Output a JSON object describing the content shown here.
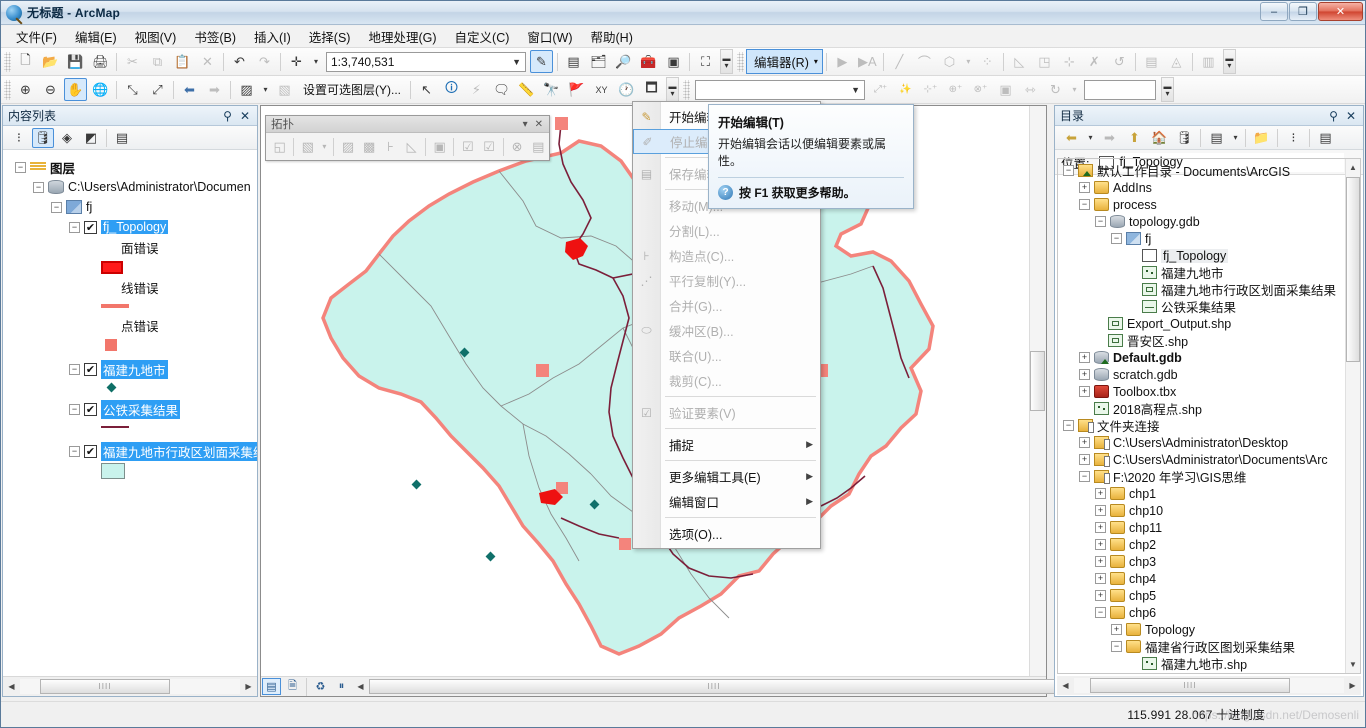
{
  "window": {
    "title": "无标题 - ArcMap",
    "minimize": "–",
    "maximize": "❐",
    "close": "✕"
  },
  "menubar": {
    "items": [
      {
        "label": "文件(F)"
      },
      {
        "label": "编辑(E)"
      },
      {
        "label": "视图(V)"
      },
      {
        "label": "书签(B)"
      },
      {
        "label": "插入(I)"
      },
      {
        "label": "选择(S)"
      },
      {
        "label": "地理处理(G)"
      },
      {
        "label": "自定义(C)"
      },
      {
        "label": "窗口(W)"
      },
      {
        "label": "帮助(H)"
      }
    ]
  },
  "toolbar_standard": {
    "scale_value": "1:3,740,531",
    "buttons": [
      {
        "name": "new-document",
        "glyph": "🗋"
      },
      {
        "name": "open-document",
        "glyph": "📂"
      },
      {
        "name": "save-document",
        "glyph": "💾"
      },
      {
        "name": "print-document",
        "glyph": "🖨"
      },
      {
        "name": "cut",
        "glyph": "✂"
      },
      {
        "name": "copy",
        "glyph": "⧉"
      },
      {
        "name": "paste",
        "glyph": "📋"
      },
      {
        "name": "delete",
        "glyph": "✕"
      },
      {
        "name": "undo",
        "glyph": "↶"
      },
      {
        "name": "redo",
        "glyph": "↷"
      },
      {
        "name": "add-data",
        "glyph": "✛"
      }
    ],
    "right_buttons": [
      {
        "name": "editor-toolbar-toggle",
        "glyph": "✎"
      },
      {
        "name": "table-of-contents",
        "glyph": "▤"
      },
      {
        "name": "catalog-window",
        "glyph": "🗂"
      },
      {
        "name": "search-window",
        "glyph": "🔎"
      },
      {
        "name": "arctoolbox-window",
        "glyph": "🧰"
      },
      {
        "name": "python-window",
        "glyph": "▣"
      },
      {
        "name": "model-builder",
        "glyph": "⛶"
      }
    ]
  },
  "toolbar_tools": {
    "select_layer_label": "设置可选图层(Y)...",
    "buttons": [
      {
        "name": "zoom-in",
        "glyph": "⊕"
      },
      {
        "name": "zoom-out",
        "glyph": "⊖"
      },
      {
        "name": "pan",
        "glyph": "✋"
      },
      {
        "name": "full-extent",
        "glyph": "🌐"
      },
      {
        "name": "fixed-zoom-in",
        "glyph": "⤡"
      },
      {
        "name": "fixed-zoom-out",
        "glyph": "⤢"
      },
      {
        "name": "previous-extent",
        "glyph": "⬅"
      },
      {
        "name": "next-extent",
        "glyph": "➡"
      },
      {
        "name": "select-features",
        "glyph": "▨"
      },
      {
        "name": "clear-selection",
        "glyph": "▧"
      },
      {
        "name": "select-elements",
        "glyph": "↖"
      },
      {
        "name": "identify",
        "glyph": "🛈"
      },
      {
        "name": "hyperlink",
        "glyph": "⚡"
      },
      {
        "name": "html-popup",
        "glyph": "🗨"
      },
      {
        "name": "measure",
        "glyph": "📏"
      },
      {
        "name": "find",
        "glyph": "🔭"
      },
      {
        "name": "find-route",
        "glyph": "🚩"
      },
      {
        "name": "go-to-xy",
        "glyph": "XY"
      },
      {
        "name": "time-slider",
        "glyph": "🕐"
      },
      {
        "name": "create-viewer-window",
        "glyph": "🗖"
      }
    ]
  },
  "editor_toolbar": {
    "button_label": "编辑器(R)",
    "caret": "▾",
    "tools": [
      {
        "name": "edit-tool",
        "glyph": "▶"
      },
      {
        "name": "edit-annotation-tool",
        "glyph": "▶A"
      },
      {
        "name": "straight-segment",
        "glyph": "╱"
      },
      {
        "name": "curve-segment",
        "glyph": "⌒"
      },
      {
        "name": "trace-tool",
        "glyph": "⬡"
      },
      {
        "name": "split-tool",
        "glyph": "⁘"
      },
      {
        "name": "reshape-feature",
        "glyph": "◺"
      },
      {
        "name": "rotate-tool",
        "glyph": "◳"
      },
      {
        "name": "mirror-features",
        "glyph": "⊹"
      },
      {
        "name": "topology-edit",
        "glyph": "✗"
      },
      {
        "name": "modify-feature",
        "glyph": "↺"
      },
      {
        "name": "attributes",
        "glyph": "▤"
      },
      {
        "name": "sketch-properties",
        "glyph": "◬"
      },
      {
        "name": "create-features-window",
        "glyph": "▥"
      }
    ],
    "snapping_tools": [
      {
        "name": "create-feature",
        "glyph": "⤢⁺"
      },
      {
        "name": "magic-wand",
        "glyph": "✨"
      },
      {
        "name": "add-vertex",
        "glyph": "⊹⁺"
      },
      {
        "name": "append-vertex",
        "glyph": "⊕⁺"
      },
      {
        "name": "delete-vertex",
        "glyph": "⊗⁺"
      },
      {
        "name": "rectangle-tool",
        "glyph": "▣"
      },
      {
        "name": "dimension-tool",
        "glyph": "⇿"
      },
      {
        "name": "rotate",
        "glyph": "↻"
      }
    ],
    "angle_value": ""
  },
  "editor_menu": {
    "items": [
      {
        "label": "开始编辑(T)",
        "icon": "pencil-start-icon",
        "glyph": "✎",
        "state": "highlighted",
        "submenu": false
      },
      {
        "label": "停止编辑",
        "icon": "pencil-stop-icon",
        "glyph": "✐",
        "state": "disabled-selected",
        "submenu": false
      },
      {
        "label": "保存编辑",
        "icon": "save-edits-icon",
        "glyph": "▤",
        "state": "disabled",
        "submenu": false
      },
      {
        "label": "移动(M)...",
        "icon": "",
        "glyph": "",
        "state": "disabled",
        "submenu": false
      },
      {
        "label": "分割(L)...",
        "icon": "",
        "glyph": "",
        "state": "disabled",
        "submenu": false
      },
      {
        "label": "构造点(C)...",
        "icon": "construct-points-icon",
        "glyph": "⊦",
        "state": "disabled",
        "submenu": false
      },
      {
        "label": "平行复制(Y)...",
        "icon": "copy-parallel-icon",
        "glyph": "⋰",
        "state": "disabled",
        "submenu": false
      },
      {
        "label": "合并(G)...",
        "icon": "",
        "glyph": "",
        "state": "disabled",
        "submenu": false
      },
      {
        "label": "缓冲区(B)...",
        "icon": "buffer-icon",
        "glyph": "⬭",
        "state": "disabled",
        "submenu": false
      },
      {
        "label": "联合(U)...",
        "icon": "",
        "glyph": "",
        "state": "disabled",
        "submenu": false
      },
      {
        "label": "裁剪(C)...",
        "icon": "",
        "glyph": "",
        "state": "disabled",
        "submenu": false
      },
      {
        "label": "验证要素(V)",
        "icon": "validate-features-icon",
        "glyph": "☑",
        "state": "disabled",
        "submenu": false
      },
      {
        "label": "捕捉",
        "icon": "",
        "glyph": "",
        "state": "enabled",
        "submenu": true
      },
      {
        "label": "更多编辑工具(E)",
        "icon": "",
        "glyph": "",
        "state": "enabled",
        "submenu": true
      },
      {
        "label": "编辑窗口",
        "icon": "",
        "glyph": "",
        "state": "enabled",
        "submenu": true
      },
      {
        "label": "选项(O)...",
        "icon": "",
        "glyph": "",
        "state": "enabled",
        "submenu": false
      }
    ],
    "separators_after": [
      2,
      5,
      10,
      11,
      12,
      14
    ],
    "submenu_arrow": "▶"
  },
  "tooltip": {
    "title": "开始编辑(T)",
    "body": "开始编辑会话以便编辑要素或属性。",
    "footer": "按 F1 获取更多帮助。",
    "help_glyph": "?"
  },
  "toc": {
    "title": "内容列表",
    "pin": "📌",
    "close": "✕",
    "tools": [
      {
        "name": "list-by-drawing-order",
        "glyph": "⁝"
      },
      {
        "name": "list-by-source",
        "glyph": "🛢",
        "active": true
      },
      {
        "name": "list-by-visibility",
        "glyph": "◈"
      },
      {
        "name": "list-by-selection",
        "glyph": "◩"
      },
      {
        "name": "options",
        "glyph": "▤"
      }
    ],
    "tree": [
      {
        "indent": 0,
        "expander": "−",
        "icon": "layers-icon",
        "label": "图层",
        "bold": true,
        "checkbox": false,
        "selected": false
      },
      {
        "indent": 1,
        "expander": "−",
        "icon": "gdb-icon",
        "label": "C:\\Users\\Administrator\\Documen",
        "checkbox": false,
        "selected": false
      },
      {
        "indent": 2,
        "expander": "−",
        "icon": "feature-dataset-icon",
        "label": "fj",
        "checkbox": false,
        "selected": false
      },
      {
        "indent": 3,
        "expander": "−",
        "icon": "topology-icon",
        "label": "fj_Topology",
        "checkbox": true,
        "selected": true
      },
      {
        "indent": 5,
        "expander": "",
        "icon": "",
        "label": "面错误",
        "checkbox": false,
        "selected": false
      },
      {
        "indent": 5,
        "swatch": "polygon-error-swatch",
        "label": ""
      },
      {
        "indent": 5,
        "expander": "",
        "icon": "",
        "label": "线错误",
        "checkbox": false,
        "selected": false
      },
      {
        "indent": 5,
        "swatch": "line-error-swatch",
        "label": ""
      },
      {
        "indent": 5,
        "expander": "",
        "icon": "",
        "label": "点错误",
        "checkbox": false,
        "selected": false
      },
      {
        "indent": 5,
        "swatch": "point-error-swatch",
        "label": ""
      },
      {
        "indent": 3,
        "expander": "−",
        "icon": "",
        "label": "福建九地市",
        "checkbox": true,
        "selected": true
      },
      {
        "indent": 5,
        "swatch": "dot-swatch",
        "label": ""
      },
      {
        "indent": 3,
        "expander": "−",
        "icon": "",
        "label": "公铁采集结果",
        "checkbox": true,
        "selected": true
      },
      {
        "indent": 5,
        "swatch": "line-swatch",
        "label": ""
      },
      {
        "indent": 3,
        "expander": "−",
        "icon": "",
        "label": "福建九地市行政区划面采集结",
        "checkbox": true,
        "selected": true
      },
      {
        "indent": 5,
        "swatch": "polygon-swatch",
        "label": ""
      }
    ]
  },
  "topology_toolbar": {
    "title": "拓扑",
    "collapse": "▾",
    "close": "✕",
    "buttons": [
      {
        "name": "map-topology-icon",
        "glyph": "◱"
      },
      {
        "name": "select-topology-icon",
        "glyph": "▧"
      },
      {
        "name": "topology-dropdown-caret",
        "glyph": "▾"
      },
      {
        "name": "show-shared-features-icon",
        "glyph": "▨"
      },
      {
        "name": "modify-edge-icon",
        "glyph": "▩"
      },
      {
        "name": "reshape-edge-icon",
        "glyph": "⊦"
      },
      {
        "name": "construct-features-icon",
        "glyph": "◺"
      },
      {
        "name": "planarize-lines-icon",
        "glyph": "▣"
      },
      {
        "name": "validate-topology-current-extent-icon",
        "glyph": "☑"
      },
      {
        "name": "validate-topology-specified-area-icon",
        "glyph": "☑"
      },
      {
        "name": "fix-topology-error-icon",
        "glyph": "⊗"
      },
      {
        "name": "error-inspector-icon",
        "glyph": "▤"
      }
    ]
  },
  "catalog": {
    "title": "目录",
    "pin": "📌",
    "close": "✕",
    "tools": [
      {
        "name": "back-icon",
        "glyph": "⬅"
      },
      {
        "name": "back-dropdown-caret",
        "glyph": "▾"
      },
      {
        "name": "forward-icon",
        "glyph": "➡"
      },
      {
        "name": "up-one-level-icon",
        "glyph": "⬆"
      },
      {
        "name": "home-icon",
        "glyph": "🏠"
      },
      {
        "name": "default-geodatabase-icon",
        "glyph": "🛢"
      },
      {
        "name": "toggle-contents-panel-icon",
        "glyph": "▤"
      },
      {
        "name": "contents-dropdown-caret",
        "glyph": "▾"
      },
      {
        "name": "connect-to-folder-icon",
        "glyph": "📁"
      },
      {
        "name": "toggle-tree-icon",
        "glyph": "⁝"
      },
      {
        "name": "catalog-options-icon",
        "glyph": "▤"
      }
    ],
    "location_label": "位置:",
    "location_value": "fj_Topology",
    "location_caret": "▾",
    "tree": [
      {
        "indent": 0,
        "expander": "−",
        "icon": "home-folder-icon",
        "label": "默认工作目录 - Documents\\ArcGIS",
        "bold": false
      },
      {
        "indent": 1,
        "expander": "+",
        "icon": "folder-icon",
        "label": "AddIns",
        "bold": false
      },
      {
        "indent": 1,
        "expander": "−",
        "icon": "folder-icon",
        "label": "process",
        "bold": false
      },
      {
        "indent": 2,
        "expander": "−",
        "icon": "gdb-icon",
        "label": "topology.gdb",
        "bold": false
      },
      {
        "indent": 3,
        "expander": "−",
        "icon": "feature-dataset-icon",
        "label": "fj",
        "bold": false
      },
      {
        "indent": 4,
        "expander": "",
        "icon": "topology-icon",
        "label": "fj_Topology",
        "bold": false,
        "selected": true
      },
      {
        "indent": 4,
        "expander": "",
        "icon": "point-fc-icon",
        "label": "福建九地市",
        "bold": false
      },
      {
        "indent": 4,
        "expander": "",
        "icon": "polygon-fc-icon",
        "label": "福建九地市行政区划面采集结果",
        "bold": false
      },
      {
        "indent": 4,
        "expander": "",
        "icon": "line-fc-icon",
        "label": "公铁采集结果",
        "bold": false
      },
      {
        "indent": 3,
        "expander": "",
        "icon": "polygon-fc-icon",
        "label": "Export_Output.shp",
        "bold": false
      },
      {
        "indent": 3,
        "expander": "",
        "icon": "polygon-fc-icon",
        "label": "晋安区.shp",
        "bold": false
      },
      {
        "indent": 1,
        "expander": "+",
        "icon": "default-gdb-icon",
        "label": "Default.gdb",
        "bold": true
      },
      {
        "indent": 1,
        "expander": "+",
        "icon": "gdb-icon",
        "label": "scratch.gdb",
        "bold": false
      },
      {
        "indent": 1,
        "expander": "+",
        "icon": "toolbox-icon",
        "label": "Toolbox.tbx",
        "bold": false
      },
      {
        "indent": 1,
        "expander": "",
        "icon": "point-fc-icon",
        "label": "2018高程点.shp",
        "bold": false
      },
      {
        "indent": 0,
        "expander": "−",
        "icon": "folder-connection-icon",
        "label": "文件夹连接",
        "bold": false
      },
      {
        "indent": 1,
        "expander": "+",
        "icon": "folder-icon",
        "label": "C:\\Users\\Administrator\\Desktop",
        "bold": false
      },
      {
        "indent": 1,
        "expander": "+",
        "icon": "folder-icon",
        "label": "C:\\Users\\Administrator\\Documents\\Arc",
        "bold": false
      },
      {
        "indent": 1,
        "expander": "−",
        "icon": "folder-icon",
        "label": "F:\\2020 年学习\\GIS思维",
        "bold": false
      },
      {
        "indent": 2,
        "expander": "+",
        "icon": "folder-icon",
        "label": "chp1",
        "bold": false
      },
      {
        "indent": 2,
        "expander": "+",
        "icon": "folder-icon",
        "label": "chp10",
        "bold": false
      },
      {
        "indent": 2,
        "expander": "+",
        "icon": "folder-icon",
        "label": "chp11",
        "bold": false
      },
      {
        "indent": 2,
        "expander": "+",
        "icon": "folder-icon",
        "label": "chp2",
        "bold": false
      },
      {
        "indent": 2,
        "expander": "+",
        "icon": "folder-icon",
        "label": "chp3",
        "bold": false
      },
      {
        "indent": 2,
        "expander": "+",
        "icon": "folder-icon",
        "label": "chp4",
        "bold": false
      },
      {
        "indent": 2,
        "expander": "+",
        "icon": "folder-icon",
        "label": "chp5",
        "bold": false
      },
      {
        "indent": 2,
        "expander": "−",
        "icon": "folder-icon",
        "label": "chp6",
        "bold": false
      },
      {
        "indent": 3,
        "expander": "+",
        "icon": "folder-icon",
        "label": "Topology",
        "bold": false
      },
      {
        "indent": 3,
        "expander": "−",
        "icon": "folder-icon",
        "label": "福建省行政区图划采集结果",
        "bold": false
      },
      {
        "indent": 4,
        "expander": "",
        "icon": "point-fc-icon",
        "label": "福建九地市.shp",
        "bold": false
      }
    ]
  },
  "map_bottom_bar": {
    "buttons": [
      {
        "name": "data-view-icon",
        "glyph": "▤",
        "active": true
      },
      {
        "name": "layout-view-icon",
        "glyph": "🗎",
        "active": false
      },
      {
        "name": "refresh-view-icon",
        "glyph": "♻",
        "active": false
      },
      {
        "name": "pause-drawing-icon",
        "glyph": "⏸",
        "active": false
      }
    ]
  },
  "statusbar": {
    "coordinates": "115.991  28.067 十进制度",
    "watermark": "https://blog.csdn.net/Demosenli"
  }
}
